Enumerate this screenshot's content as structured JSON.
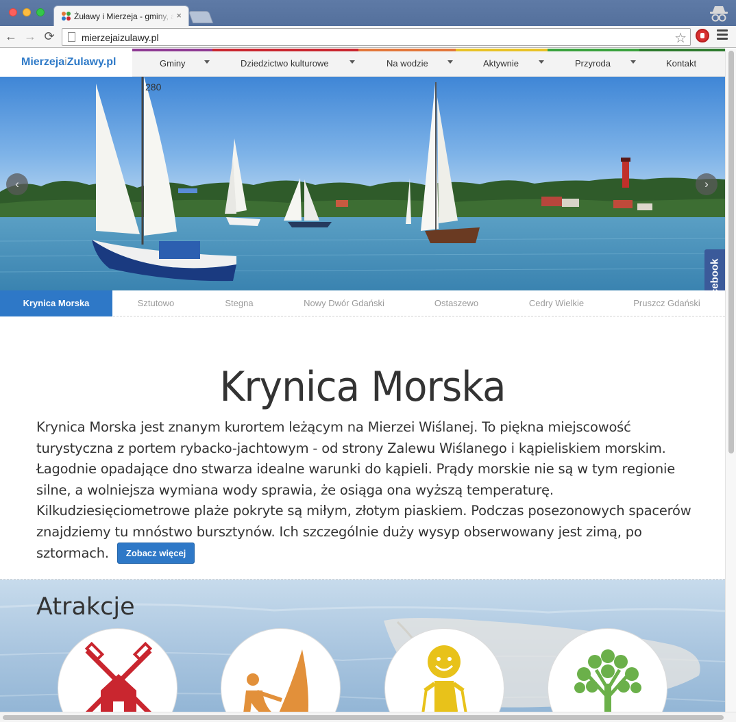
{
  "browser": {
    "tab_title": "Żuławy i Mierzeja - gminy, atrakcje",
    "tab_close": "×",
    "url": "mierzejaizulawy.pl",
    "back_glyph": "←",
    "forward_glyph": "→",
    "reload_glyph": "⟳",
    "star_glyph": "☆"
  },
  "site": {
    "logo": {
      "part1": "Mierzeja",
      "sep": "i",
      "part2": "Zulawy.pl"
    },
    "nav": [
      {
        "label": "Gminy",
        "color": "#8e3a93"
      },
      {
        "label": "Dziedzictwo kulturowe",
        "color": "#c9262f"
      },
      {
        "label": "Na wodzie",
        "color": "#e2763a"
      },
      {
        "label": "Aktywnie",
        "color": "#e8c226"
      },
      {
        "label": "Przyroda",
        "color": "#3aa23d"
      },
      {
        "label": "Kontakt",
        "color": "#2e7a2e"
      }
    ]
  },
  "carousel": {
    "prev_glyph": "‹",
    "next_glyph": "›"
  },
  "facebook_label": "facebook",
  "towns": {
    "items": [
      "Krynica Morska",
      "Sztutowo",
      "Stegna",
      "Nowy Dwór Gdański",
      "Ostaszewo",
      "Cedry Wielkie",
      "Pruszcz Gdański"
    ],
    "active": "Krynica Morska"
  },
  "content": {
    "title": "Krynica Morska",
    "body": "Krynica Morska jest znanym kurortem leżącym na Mierzei Wiślanej. To piękna miejscowość turystyczna z portem rybacko-jachtowym - od strony Zalewu Wiślanego i kąpieliskiem morskim. Łagodnie opadające dno stwarza idealne warunki do kąpieli. Prądy morskie nie są w tym regionie silne, a wolniejsza wymiana wody sprawia, że osiąga ona wyższą temperaturę. Kilkudziesięciometrowe plaże pokryte są miłym, złotym piaskiem. Podczas posezonowych spacerów znajdziemy tu mnóstwo bursztynów. Ich szczególnie duży wysyp obserwowany jest zimą, po sztormach.",
    "more_button": "Zobacz więcej"
  },
  "attractions": {
    "heading": "Atrakcje",
    "items": [
      {
        "icon": "windmill-icon",
        "color": "#c9262f"
      },
      {
        "icon": "sailing-icon",
        "color": "#e2903a"
      },
      {
        "icon": "hiker-icon",
        "color": "#e8c21a"
      },
      {
        "icon": "tree-icon",
        "color": "#6bb04a"
      }
    ]
  },
  "colors": {
    "accent": "#2e78c7",
    "facebook": "#3b5a9a"
  }
}
